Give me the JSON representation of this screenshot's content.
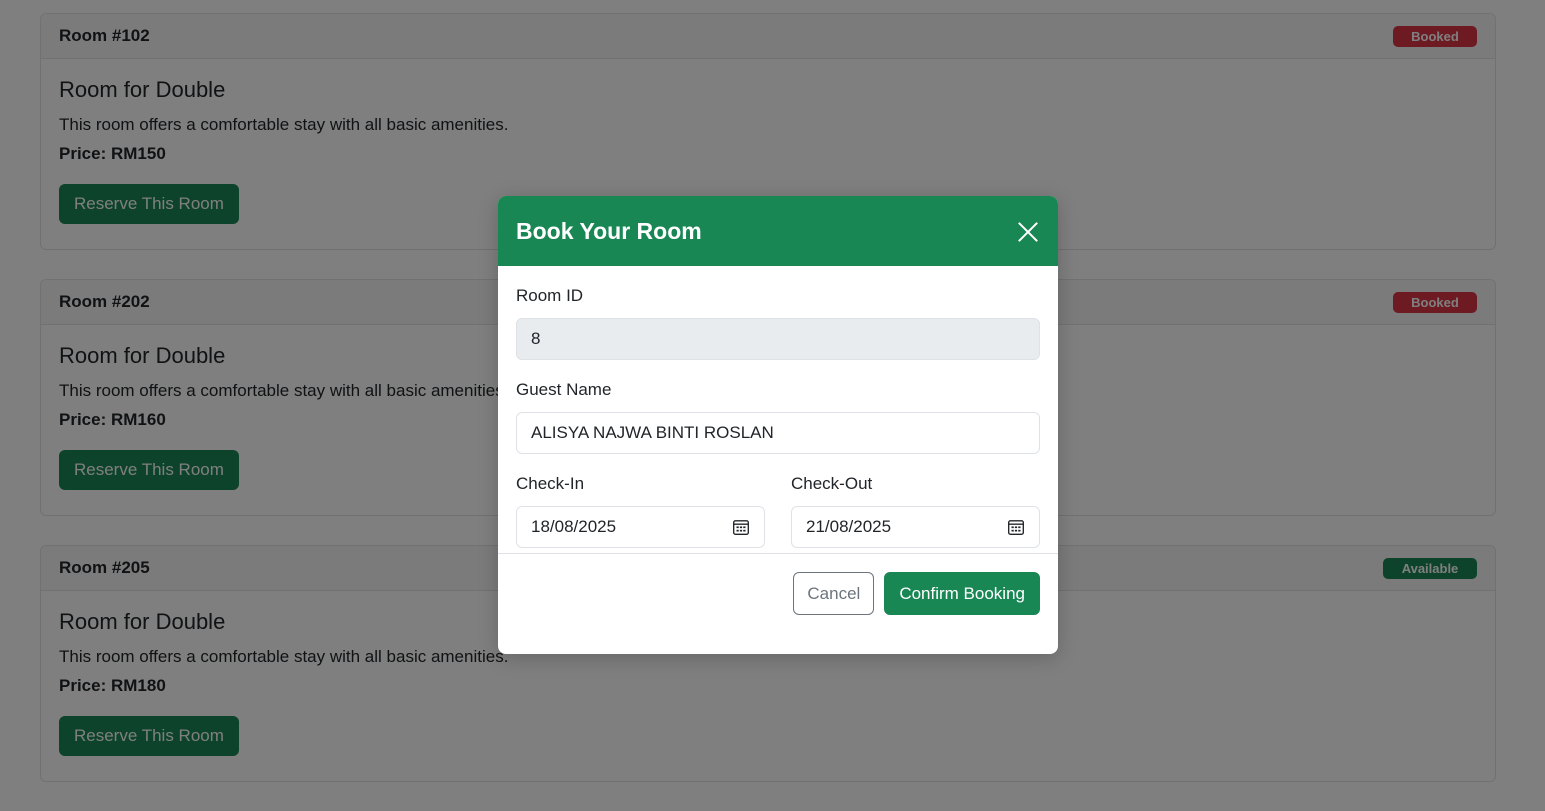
{
  "rooms": [
    {
      "number": "Room #102",
      "status": "Booked",
      "title": "Room for Double",
      "description": "This room offers a comfortable stay with all basic amenities.",
      "price": "Price: RM150",
      "button": "Reserve This Room"
    },
    {
      "number": "Room #202",
      "status": "Booked",
      "title": "Room for Double",
      "description": "This room offers a comfortable stay with all basic amenities.",
      "price": "Price: RM160",
      "button": "Reserve This Room"
    },
    {
      "number": "Room #205",
      "status": "Available",
      "title": "Room for Double",
      "description": "This room offers a comfortable stay with all basic amenities.",
      "price": "Price: RM180",
      "button": "Reserve This Room"
    }
  ],
  "modal": {
    "title": "Book Your Room",
    "room_id_label": "Room ID",
    "room_id_value": "8",
    "guest_name_label": "Guest Name",
    "guest_name_value": "ALISYA NAJWA BINTI ROSLAN",
    "check_in_label": "Check-In",
    "check_in_value": "18/08/2025",
    "check_out_label": "Check-Out",
    "check_out_value": "21/08/2025",
    "cancel_label": "Cancel",
    "confirm_label": "Confirm Booking"
  },
  "colors": {
    "primary_green": "#198754",
    "booked_red": "#dc3545",
    "backdrop": "rgba(0,0,0,0.5)"
  },
  "icons": {
    "close": "close-icon",
    "calendar": "calendar-icon"
  }
}
